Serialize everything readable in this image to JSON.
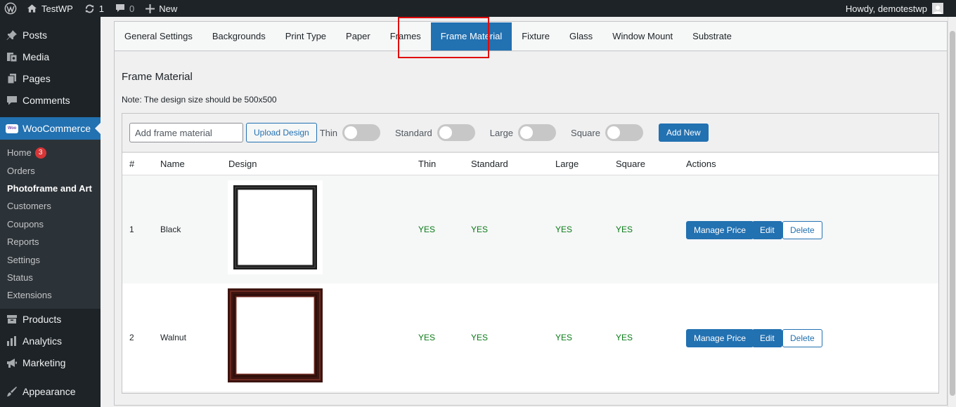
{
  "adminbar": {
    "site_name": "TestWP",
    "updates_count": "1",
    "comments_count": "0",
    "new_label": "New",
    "greeting": "Howdy, demotestwp"
  },
  "sidebar": {
    "top_items": [
      "Posts",
      "Media",
      "Pages",
      "Comments"
    ],
    "current": "WooCommerce",
    "submenu": [
      {
        "label": "Home",
        "badge": "3"
      },
      {
        "label": "Orders"
      },
      {
        "label": "Photoframe and Art"
      },
      {
        "label": "Customers"
      },
      {
        "label": "Coupons"
      },
      {
        "label": "Reports"
      },
      {
        "label": "Settings"
      },
      {
        "label": "Status"
      },
      {
        "label": "Extensions"
      }
    ],
    "bottom_items": [
      "Products",
      "Analytics",
      "Marketing",
      "Appearance"
    ]
  },
  "tabs": [
    "General Settings",
    "Backgrounds",
    "Print Type",
    "Paper",
    "Frames",
    "Frame Material",
    "Fixture",
    "Glass",
    "Window Mount",
    "Substrate"
  ],
  "active_tab": "Frame Material",
  "section": {
    "title": "Frame Material",
    "note": "Note: The design size should be 500x500"
  },
  "form": {
    "input_placeholder": "Add frame material",
    "upload_label": "Upload Design",
    "toggles": [
      "Thin",
      "Standard",
      "Large",
      "Square"
    ],
    "add_label": "Add New"
  },
  "table": {
    "headers": [
      "#",
      "Name",
      "Design",
      "Thin",
      "Standard",
      "Large",
      "Square",
      "Actions"
    ],
    "rows": [
      {
        "num": "1",
        "name": "Black",
        "design_color": "#1a1a1a",
        "thin": "YES",
        "standard": "YES",
        "large": "YES",
        "square": "YES"
      },
      {
        "num": "2",
        "name": "Walnut",
        "design_color": "#3d1410",
        "thin": "YES",
        "standard": "YES",
        "large": "YES",
        "square": "YES"
      }
    ],
    "actions": {
      "manage": "Manage Price",
      "edit": "Edit",
      "delete": "Delete"
    }
  },
  "colors": {
    "admin_dark": "#1d2327",
    "wp_blue": "#2271b1",
    "yes_green": "#0a7b18",
    "highlight_red": "#e00b0b"
  }
}
